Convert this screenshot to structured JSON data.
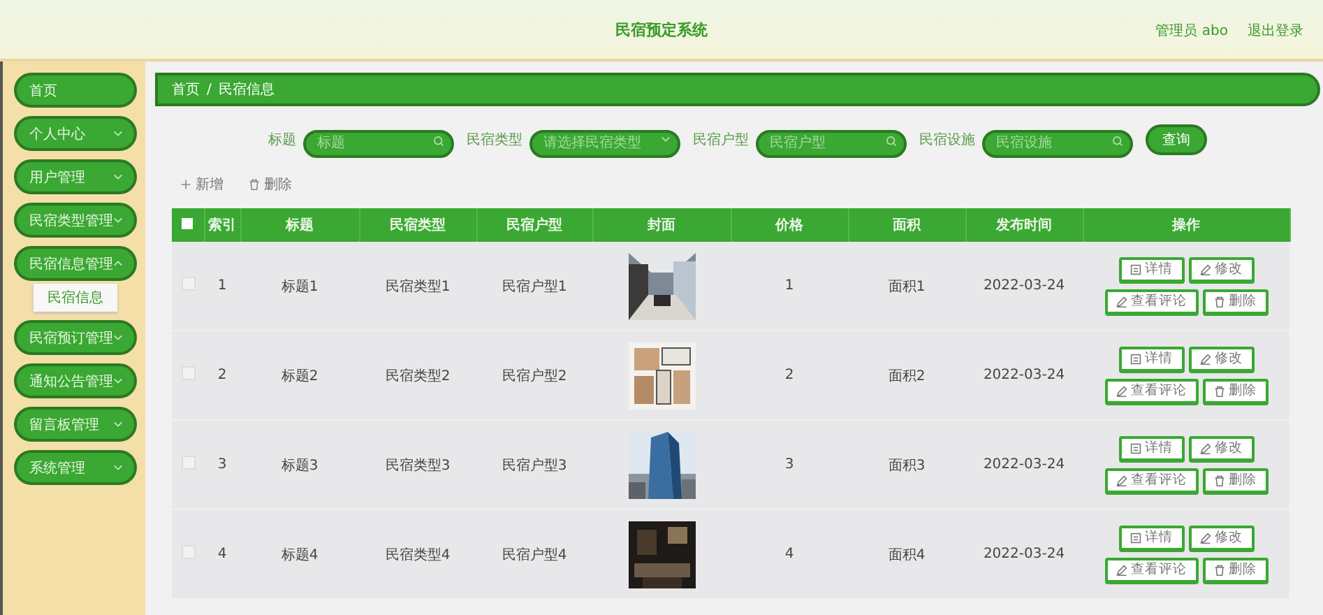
{
  "header": {
    "title": "民宿预定系统",
    "user": "管理员 abo",
    "logout": "退出登录"
  },
  "sidebar": {
    "items": [
      {
        "label": "首页",
        "kind": "link"
      },
      {
        "label": "个人中心",
        "kind": "menu",
        "expanded": false
      },
      {
        "label": "用户管理",
        "kind": "menu",
        "expanded": false
      },
      {
        "label": "民宿类型管理",
        "kind": "menu",
        "expanded": false
      },
      {
        "label": "民宿信息管理",
        "kind": "menu",
        "expanded": true,
        "children": [
          {
            "label": "民宿信息"
          }
        ]
      },
      {
        "label": "民宿预订管理",
        "kind": "menu",
        "expanded": false
      },
      {
        "label": "通知公告管理",
        "kind": "menu",
        "expanded": false
      },
      {
        "label": "留言板管理",
        "kind": "menu",
        "expanded": false
      },
      {
        "label": "系统管理",
        "kind": "menu",
        "expanded": false
      }
    ]
  },
  "breadcrumb": {
    "items": [
      "首页",
      "民宿信息"
    ],
    "separator": "/"
  },
  "filters": [
    {
      "label": "标题",
      "placeholder": "标题",
      "kind": "search"
    },
    {
      "label": "民宿类型",
      "placeholder": "请选择民宿类型",
      "kind": "select"
    },
    {
      "label": "民宿户型",
      "placeholder": "民宿户型",
      "kind": "search"
    },
    {
      "label": "民宿设施",
      "placeholder": "民宿设施",
      "kind": "search"
    }
  ],
  "search_button": "查询",
  "toolbar": [
    {
      "label": "新增",
      "kind": "add"
    },
    {
      "label": "删除",
      "kind": "delete"
    }
  ],
  "table": {
    "select_all": false,
    "columns": [
      "索引",
      "标题",
      "民宿类型",
      "民宿户型",
      "封面",
      "价格",
      "面积",
      "发布时间",
      "操作"
    ],
    "rows": [
      {
        "checked": false,
        "cells": [
          "1",
          "标题1",
          "民宿类型1",
          "民宿户型1",
          "",
          "1",
          "面积1",
          "2022-03-24"
        ],
        "actions": [
          {
            "label": "详情",
            "kind": "detail"
          },
          {
            "label": "修改",
            "kind": "edit"
          },
          {
            "label": "查看评论",
            "kind": "comment"
          },
          {
            "label": "删除",
            "kind": "delete"
          }
        ]
      },
      {
        "checked": false,
        "cells": [
          "2",
          "标题2",
          "民宿类型2",
          "民宿户型2",
          "",
          "2",
          "面积2",
          "2022-03-24"
        ],
        "actions": [
          {
            "label": "详情",
            "kind": "detail"
          },
          {
            "label": "修改",
            "kind": "edit"
          },
          {
            "label": "查看评论",
            "kind": "comment"
          },
          {
            "label": "删除",
            "kind": "delete"
          }
        ]
      },
      {
        "checked": false,
        "cells": [
          "3",
          "标题3",
          "民宿类型3",
          "民宿户型3",
          "",
          "3",
          "面积3",
          "2022-03-24"
        ],
        "actions": [
          {
            "label": "详情",
            "kind": "detail"
          },
          {
            "label": "修改",
            "kind": "edit"
          },
          {
            "label": "查看评论",
            "kind": "comment"
          },
          {
            "label": "删除",
            "kind": "delete"
          }
        ]
      },
      {
        "checked": false,
        "cells": [
          "4",
          "标题4",
          "民宿类型4",
          "民宿户型4",
          "",
          "4",
          "面积4",
          "2022-03-24"
        ],
        "actions": [
          {
            "label": "详情",
            "kind": "detail"
          },
          {
            "label": "修改",
            "kind": "edit"
          },
          {
            "label": "查看评论",
            "kind": "comment"
          },
          {
            "label": "删除",
            "kind": "delete"
          }
        ]
      }
    ]
  }
}
